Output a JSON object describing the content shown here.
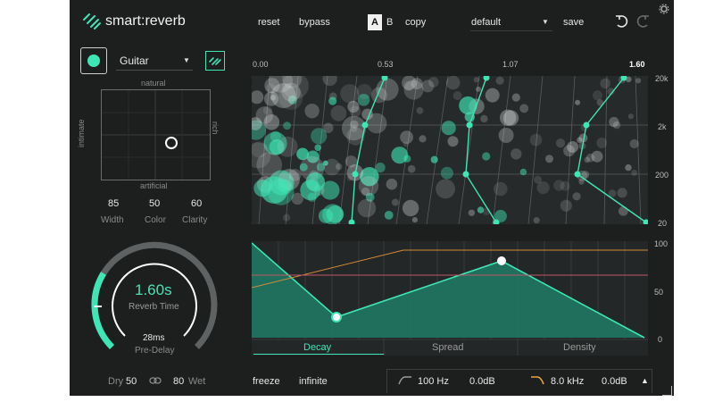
{
  "app": {
    "title": "smart:reverb",
    "accent": "#3ee6b5"
  },
  "header": {
    "reset_label": "reset",
    "bypass_label": "bypass",
    "ab_active": "A",
    "ab_inactive": "B",
    "copy_label": "copy",
    "preset_value": "default",
    "save_label": "save",
    "icons": [
      "logo-icon",
      "undo-icon",
      "redo-icon",
      "settings-icon"
    ]
  },
  "profile": {
    "selected": "Guitar"
  },
  "xy_pad": {
    "top": "natural",
    "bottom": "artificial",
    "left": "intimate",
    "right": "rich"
  },
  "params": [
    {
      "value": "85",
      "label": "Width"
    },
    {
      "value": "50",
      "label": "Color"
    },
    {
      "value": "60",
      "label": "Clarity"
    }
  ],
  "knob": {
    "time_value": "1.60s",
    "time_label": "Reverb Time",
    "predelay_value": "28ms",
    "predelay_label": "Pre-Delay"
  },
  "mix": {
    "dry_label": "Dry",
    "dry_value": "50",
    "wet_value": "80",
    "wet_label": "Wet"
  },
  "spectrum": {
    "time_ticks": [
      "0.00",
      "0.53",
      "1.07",
      "1.60"
    ],
    "freq_ticks": [
      "20k",
      "2k",
      "200",
      "20"
    ]
  },
  "envelope": {
    "y_ticks": [
      "100",
      "50",
      "0"
    ],
    "tabs": [
      "Decay",
      "Spread",
      "Density"
    ],
    "active_tab": "Decay"
  },
  "footer": {
    "freeze_label": "freeze",
    "infinite_label": "infinite",
    "lowcut_freq": "100 Hz",
    "lowcut_gain": "0.0dB",
    "highcut_freq": "8.0 kHz",
    "highcut_gain": "0.0dB"
  }
}
